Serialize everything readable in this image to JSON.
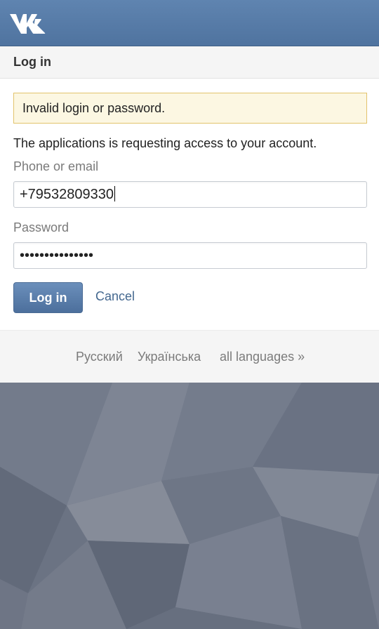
{
  "header": {
    "logo_icon": "vk-logo-icon",
    "brand_color": "#5b80ad"
  },
  "subheader": {
    "title": "Log in"
  },
  "form": {
    "error_message": "Invalid login or password.",
    "info_text": "The applications  is requesting access to your  account.",
    "phone_label": "Phone or email",
    "phone_value": "+79532809330",
    "password_label": "Password",
    "password_mask": "•••••••••••••••",
    "login_button": "Log in",
    "cancel_link": "Cancel"
  },
  "languages": {
    "items": [
      "Русский",
      "Українська",
      "all languages »"
    ]
  },
  "colors": {
    "error_bg": "#fcf7e2",
    "error_border": "#e2c36c",
    "link": "#44688f",
    "background_pattern": "#6b7280"
  }
}
